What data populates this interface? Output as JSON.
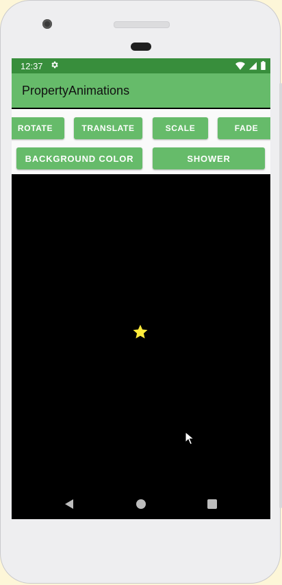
{
  "status_bar": {
    "time": "12:37",
    "icons": [
      "gear-icon",
      "wifi-icon",
      "signal-icon",
      "battery-icon"
    ],
    "color": "#388e3c"
  },
  "app_bar": {
    "title": "PropertyAnimations",
    "color": "#66bb6a"
  },
  "buttons": {
    "rotate": "ROTATE",
    "translate": "TRANSLATE",
    "scale": "SCALE",
    "fade": "FADE",
    "background_color": "BACKGROUND COLOR",
    "shower": "SHOWER"
  },
  "canvas": {
    "background": "#000000",
    "star_color": "#ffeb3b",
    "star_icon": "star-icon"
  },
  "nav_bar": {
    "items": [
      "back-icon",
      "home-icon",
      "recents-icon"
    ]
  }
}
